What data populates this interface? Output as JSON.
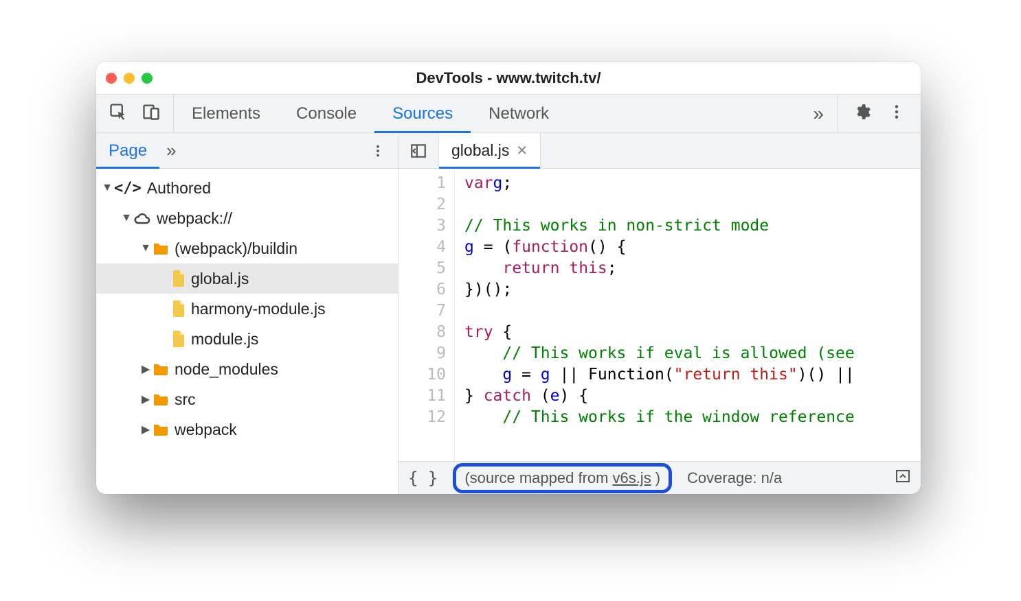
{
  "window_title": "DevTools - www.twitch.tv/",
  "top_tabs": {
    "items": [
      "Elements",
      "Console",
      "Sources",
      "Network"
    ],
    "active_index": 2,
    "overflow_glyph": "»"
  },
  "sidebar": {
    "tab_label": "Page",
    "overflow_glyph": "»",
    "tree": {
      "root_label": "Authored",
      "webpack_label": "webpack://",
      "buildin_label": "(webpack)/buildin",
      "files": [
        "global.js",
        "harmony-module.js",
        "module.js"
      ],
      "folders": [
        "node_modules",
        "src",
        "webpack"
      ],
      "selected_file_index": 0
    }
  },
  "editor": {
    "open_file": "global.js",
    "gutter": [
      "1",
      "2",
      "3",
      "4",
      "5",
      "6",
      "7",
      "8",
      "9",
      "10",
      "11",
      "12"
    ],
    "tokens": [
      [
        [
          "kw",
          "var"
        ],
        [
          "",
          ""
        ],
        [
          "ident",
          "g"
        ],
        [
          "",
          ";"
        ]
      ],
      [],
      [
        [
          "com",
          "// This works in non-strict mode"
        ]
      ],
      [
        [
          "ident",
          "g"
        ],
        [
          "",
          " = ("
        ],
        [
          "fn",
          "function"
        ],
        [
          "",
          "() {"
        ]
      ],
      [
        [
          "",
          "    "
        ],
        [
          "kw",
          "return"
        ],
        [
          "",
          " "
        ],
        [
          "this",
          "this"
        ],
        [
          "",
          ";"
        ]
      ],
      [
        [
          "",
          "})();"
        ]
      ],
      [],
      [
        [
          "kw",
          "try"
        ],
        [
          "",
          " {"
        ]
      ],
      [
        [
          "",
          "    "
        ],
        [
          "com",
          "// This works if eval is allowed (see"
        ]
      ],
      [
        [
          "",
          "    "
        ],
        [
          "ident",
          "g"
        ],
        [
          "",
          " = "
        ],
        [
          "ident",
          "g"
        ],
        [
          "",
          " || Function("
        ],
        [
          "str",
          "\"return this\""
        ],
        [
          "",
          ")() ||"
        ]
      ],
      [
        [
          "",
          "} "
        ],
        [
          "kw",
          "catch"
        ],
        [
          "",
          " ("
        ],
        [
          "ident",
          "e"
        ],
        [
          "",
          ") {"
        ]
      ],
      [
        [
          "",
          "    "
        ],
        [
          "com",
          "// This works if the window reference"
        ]
      ]
    ]
  },
  "statusbar": {
    "braces": "{ }",
    "mapped_prefix": "(source mapped from ",
    "mapped_link": "v6s.js",
    "mapped_suffix": ")",
    "coverage": "Coverage: n/a"
  }
}
